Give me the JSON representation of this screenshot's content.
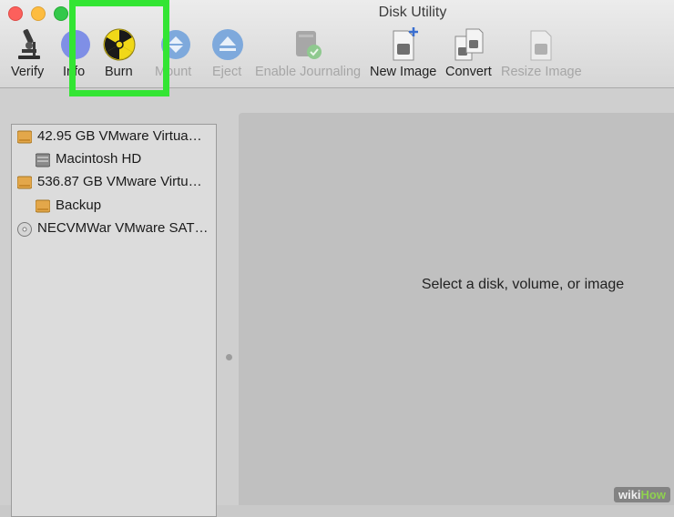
{
  "window": {
    "title": "Disk Utility"
  },
  "toolbar": {
    "verify": "Verify",
    "info": "Info",
    "burn": "Burn",
    "mount": "Mount",
    "eject": "Eject",
    "enable_journaling": "Enable Journaling",
    "new_image": "New Image",
    "convert": "Convert",
    "resize_image": "Resize Image"
  },
  "sidebar": {
    "items": [
      {
        "label": "42.95 GB VMware Virtua…",
        "icon": "hard-disk-icon"
      },
      {
        "label": "Macintosh HD",
        "icon": "volume-icon"
      },
      {
        "label": "536.87 GB VMware Virtu…",
        "icon": "hard-disk-icon"
      },
      {
        "label": "Backup",
        "icon": "volume-icon"
      },
      {
        "label": "NECVMWar VMware SAT…",
        "icon": "optical-disc-icon"
      }
    ]
  },
  "detail": {
    "message": "Select a disk, volume, or image"
  },
  "highlight": {
    "target": "Burn",
    "color": "#33e533"
  },
  "watermark": {
    "prefix": "wiki",
    "suffix": "How"
  }
}
